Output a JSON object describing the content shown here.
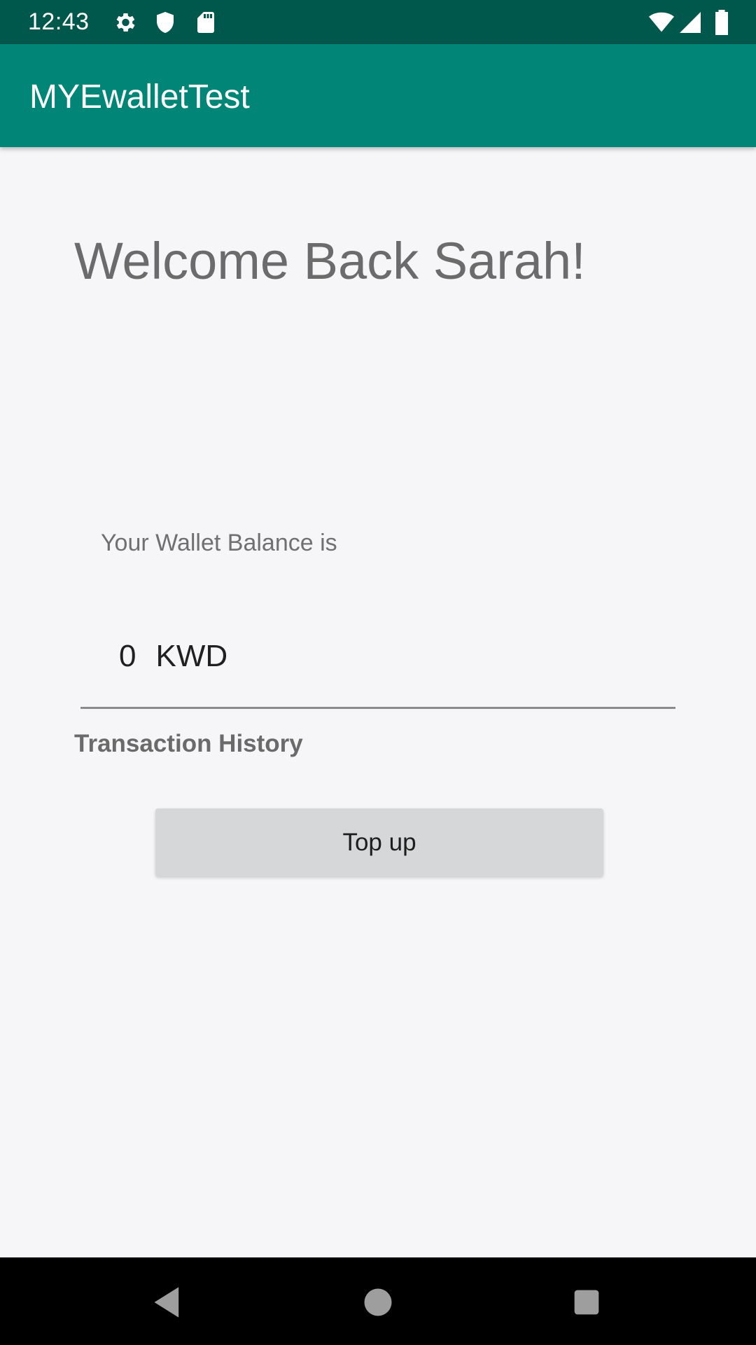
{
  "status_bar": {
    "time": "12:43",
    "icons": [
      "gear-icon",
      "shield-icon",
      "sd-card-icon",
      "wifi-icon",
      "cell-signal-icon",
      "battery-icon"
    ]
  },
  "app_bar": {
    "title": "MYEwalletTest",
    "color": "#008577"
  },
  "main": {
    "welcome": "Welcome Back Sarah!",
    "balance_label": "Your Wallet Balance is",
    "balance_amount": "0",
    "balance_currency": "KWD",
    "history_link": "Transaction History",
    "topup_label": "Top up"
  },
  "nav_bar": {
    "buttons": [
      "back-icon",
      "home-icon",
      "recents-icon"
    ]
  }
}
